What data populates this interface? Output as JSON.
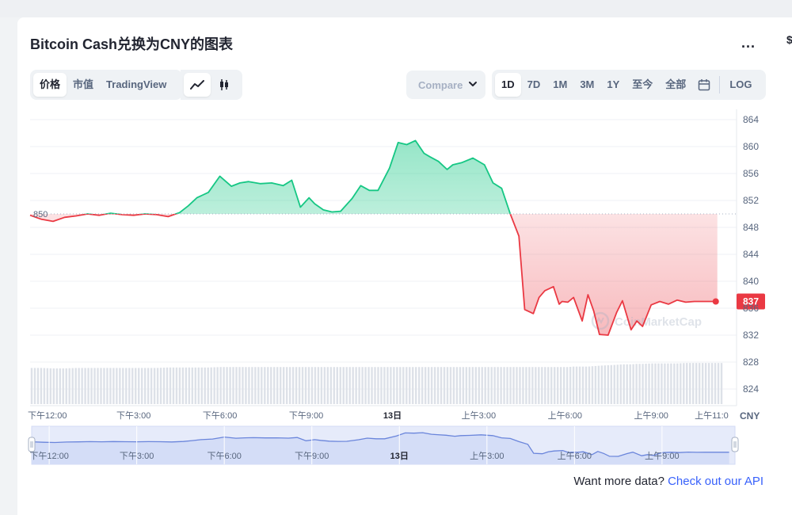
{
  "title": "Bitcoin Cash兑换为CNY的图表",
  "more_label": "...",
  "edge_char": "$",
  "tabs": {
    "price": "价格",
    "market_cap": "市值",
    "tradingview": "TradingView"
  },
  "chart_type_icons": [
    "line-chart-icon",
    "candlestick-icon"
  ],
  "compare": {
    "label": "Compare with"
  },
  "ranges": [
    "1D",
    "7D",
    "1M",
    "3M",
    "1Y",
    "至今",
    "全部"
  ],
  "active_range": "1D",
  "log_label": "LOG",
  "watermark": "CoinMarketCap",
  "footer": {
    "text": "Want more data? ",
    "link": "Check out our API"
  },
  "colors": {
    "up": "#16c784",
    "down": "#ea3943",
    "accent": "#3861fb",
    "nav": "#6a85db"
  },
  "chart_data": {
    "type": "area",
    "unit": "CNY",
    "reference_value": 850,
    "reference_label": "850",
    "current_value": 837,
    "current_label": "837",
    "ylim": [
      820,
      866
    ],
    "y_ticks": [
      864,
      860,
      856,
      852,
      848,
      844,
      840,
      836,
      832,
      828,
      824
    ],
    "x_ticks": [
      "下午12:00",
      "下午3:00",
      "下午6:00",
      "下午9:00",
      "13日",
      "上午3:00",
      "上午6:00",
      "上午9:00",
      "上午11:0"
    ],
    "x_tick_pos": [
      1.0,
      4.0,
      7.0,
      10.0,
      13.0,
      16.0,
      19.0,
      22.0,
      24.1
    ],
    "x_range": [
      0.4,
      24.5
    ],
    "series": [
      {
        "x": [
          0.4,
          0.8,
          1.2,
          1.6,
          2.0,
          2.4,
          2.8,
          3.2,
          3.6,
          4.0,
          4.4,
          4.8,
          5.2,
          5.6,
          5.9,
          6.2,
          6.6,
          7.0,
          7.4,
          7.7,
          8.0,
          8.4,
          8.8,
          9.2,
          9.5,
          9.8,
          10.1,
          10.3,
          10.6,
          10.9,
          11.2,
          11.6,
          11.9,
          12.2,
          12.5,
          12.9,
          13.2,
          13.5,
          13.8,
          14.1,
          14.3,
          14.6,
          14.9,
          15.1,
          15.4,
          15.8,
          16.2,
          16.5,
          16.8,
          17.1,
          17.4,
          17.6,
          17.9,
          18.1,
          18.3,
          18.6,
          18.8,
          18.9,
          19.1,
          19.3,
          19.6,
          19.8,
          20.0,
          20.2,
          20.5,
          20.8,
          21.0,
          21.3,
          21.5,
          21.7,
          22.0,
          22.3,
          22.6,
          22.9,
          23.2,
          23.5,
          23.8,
          24.0,
          24.3
        ],
        "y": [
          849.8,
          849.2,
          848.9,
          849.5,
          849.7,
          850.0,
          849.8,
          850.1,
          849.9,
          849.8,
          850.0,
          849.9,
          849.6,
          850.2,
          851.2,
          852.4,
          853.2,
          855.6,
          854.1,
          854.6,
          854.8,
          854.5,
          854.6,
          854.2,
          855.0,
          851.0,
          852.4,
          851.5,
          850.6,
          850.3,
          850.4,
          852.3,
          854.2,
          853.5,
          853.5,
          856.8,
          860.6,
          860.3,
          860.9,
          859.0,
          858.5,
          857.8,
          856.6,
          857.3,
          857.6,
          858.3,
          857.3,
          854.6,
          853.8,
          850.0,
          846.7,
          835.8,
          835.2,
          837.6,
          838.6,
          839.2,
          836.6,
          837.0,
          836.9,
          837.6,
          834.1,
          838.0,
          835.6,
          832.1,
          832.0,
          835.4,
          837.1,
          832.8,
          834.1,
          833.3,
          836.5,
          837.0,
          836.6,
          837.2,
          836.9,
          837.0,
          837.0,
          837.0,
          837.0
        ],
        "volume": [
          0.8,
          0.8,
          0.79,
          0.79,
          0.8,
          0.8,
          0.8,
          0.8,
          0.8,
          0.8,
          0.8,
          0.8,
          0.81,
          0.81,
          0.81,
          0.81,
          0.81,
          0.82,
          0.82,
          0.82,
          0.82,
          0.82,
          0.82,
          0.82,
          0.82,
          0.82,
          0.82,
          0.82,
          0.82,
          0.82,
          0.82,
          0.82,
          0.82,
          0.82,
          0.82,
          0.82,
          0.82,
          0.82,
          0.82,
          0.82,
          0.82,
          0.82,
          0.82,
          0.82,
          0.82,
          0.82,
          0.82,
          0.82,
          0.82,
          0.82,
          0.82,
          0.82,
          0.82,
          0.82,
          0.82,
          0.82,
          0.82,
          0.82,
          0.82,
          0.83,
          0.83,
          0.83,
          0.84,
          0.85,
          0.86,
          0.87,
          0.88,
          0.88,
          0.89,
          0.89,
          0.9,
          0.9,
          0.9,
          0.9,
          0.91,
          0.91,
          0.91,
          0.91,
          0.91
        ]
      }
    ],
    "navigator": {
      "x_ticks": [
        "下午12:00",
        "下午3:00",
        "下午6:00",
        "下午9:00",
        "13日",
        "上午3:00",
        "上午6:00",
        "上午9:00"
      ]
    }
  }
}
